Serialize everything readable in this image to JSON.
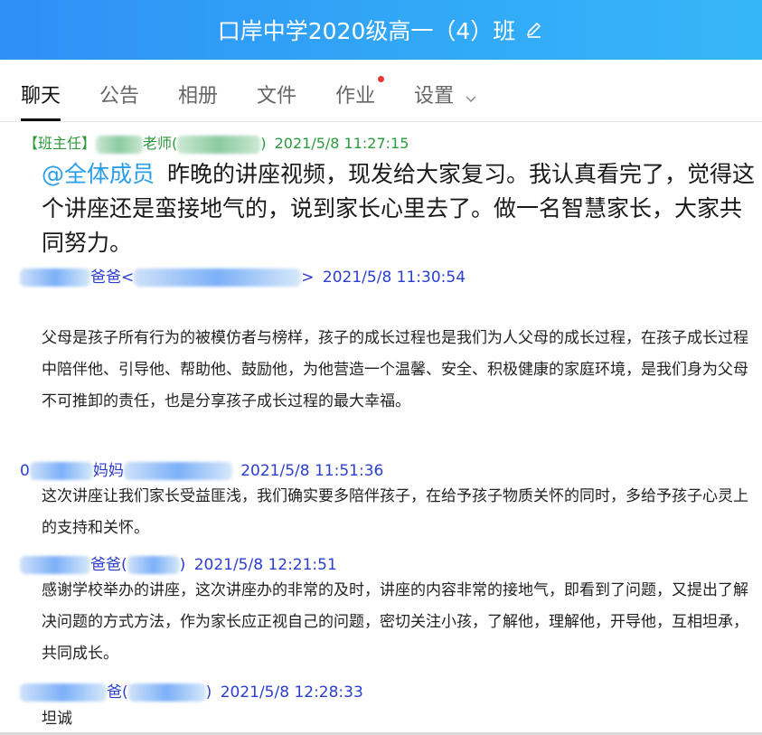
{
  "window": {
    "title": "口岸中学2020级高一（4）班",
    "edit_icon": "pencil-icon",
    "accent": "#2f8ff7"
  },
  "tabs": [
    {
      "label": "聊天",
      "active": true
    },
    {
      "label": "公告"
    },
    {
      "label": "相册"
    },
    {
      "label": "文件"
    },
    {
      "label": "作业",
      "has_badge": true
    },
    {
      "label": "设置",
      "dropdown_icon": "chevron-down-icon"
    }
  ],
  "messages": [
    {
      "sender_prefix": "【班主任】",
      "sender_suffix": "老师(",
      "sender_close": ")",
      "timestamp": "2021/5/8 11:27:15",
      "mention": "@全体成员",
      "text": "昨晚的讲座视频，现发给大家复习。我认真看完了，觉得这个讲座还是蛮接地气的，说到家长心里去了。做一名智慧家长，大家共同努力。"
    },
    {
      "sender_suffix": "爸爸<",
      "sender_close": ">",
      "timestamp": "2021/5/8 11:30:54",
      "text": "父母是孩子所有行为的被模仿者与榜样，孩子的成长过程也是我们为人父母的成长过程，在孩子成长过程中陪伴他、引导他、帮助他、鼓励他，为他营造一个温馨、安全、积极健康的家庭环境，是我们身为父母不可推卸的责任，也是分享孩子成长过程的最大幸福。"
    },
    {
      "sender_prefix": "0",
      "sender_suffix": "妈妈",
      "timestamp": "2021/5/8 11:51:36",
      "text": "这次讲座让我们家长受益匪浅，我们确实要多陪伴孩子，在给予孩子物质关怀的同时，多给予孩子心灵上的支持和关怀。"
    },
    {
      "sender_suffix": "爸爸(",
      "sender_close": ")",
      "timestamp": "2021/5/8 12:21:51",
      "text": "感谢学校举办的讲座，这次讲座办的非常的及时，讲座的内容非常的接地气，即看到了问题，又提出了解决问题的方式方法，作为家长应正视自己的问题，密切关注小孩，了解他，理解他，开导他，互相坦承，共同成长。"
    },
    {
      "sender_suffix": "爸(",
      "sender_close": ")",
      "timestamp": "2021/5/8 12:28:33",
      "text": "坦诚"
    }
  ]
}
